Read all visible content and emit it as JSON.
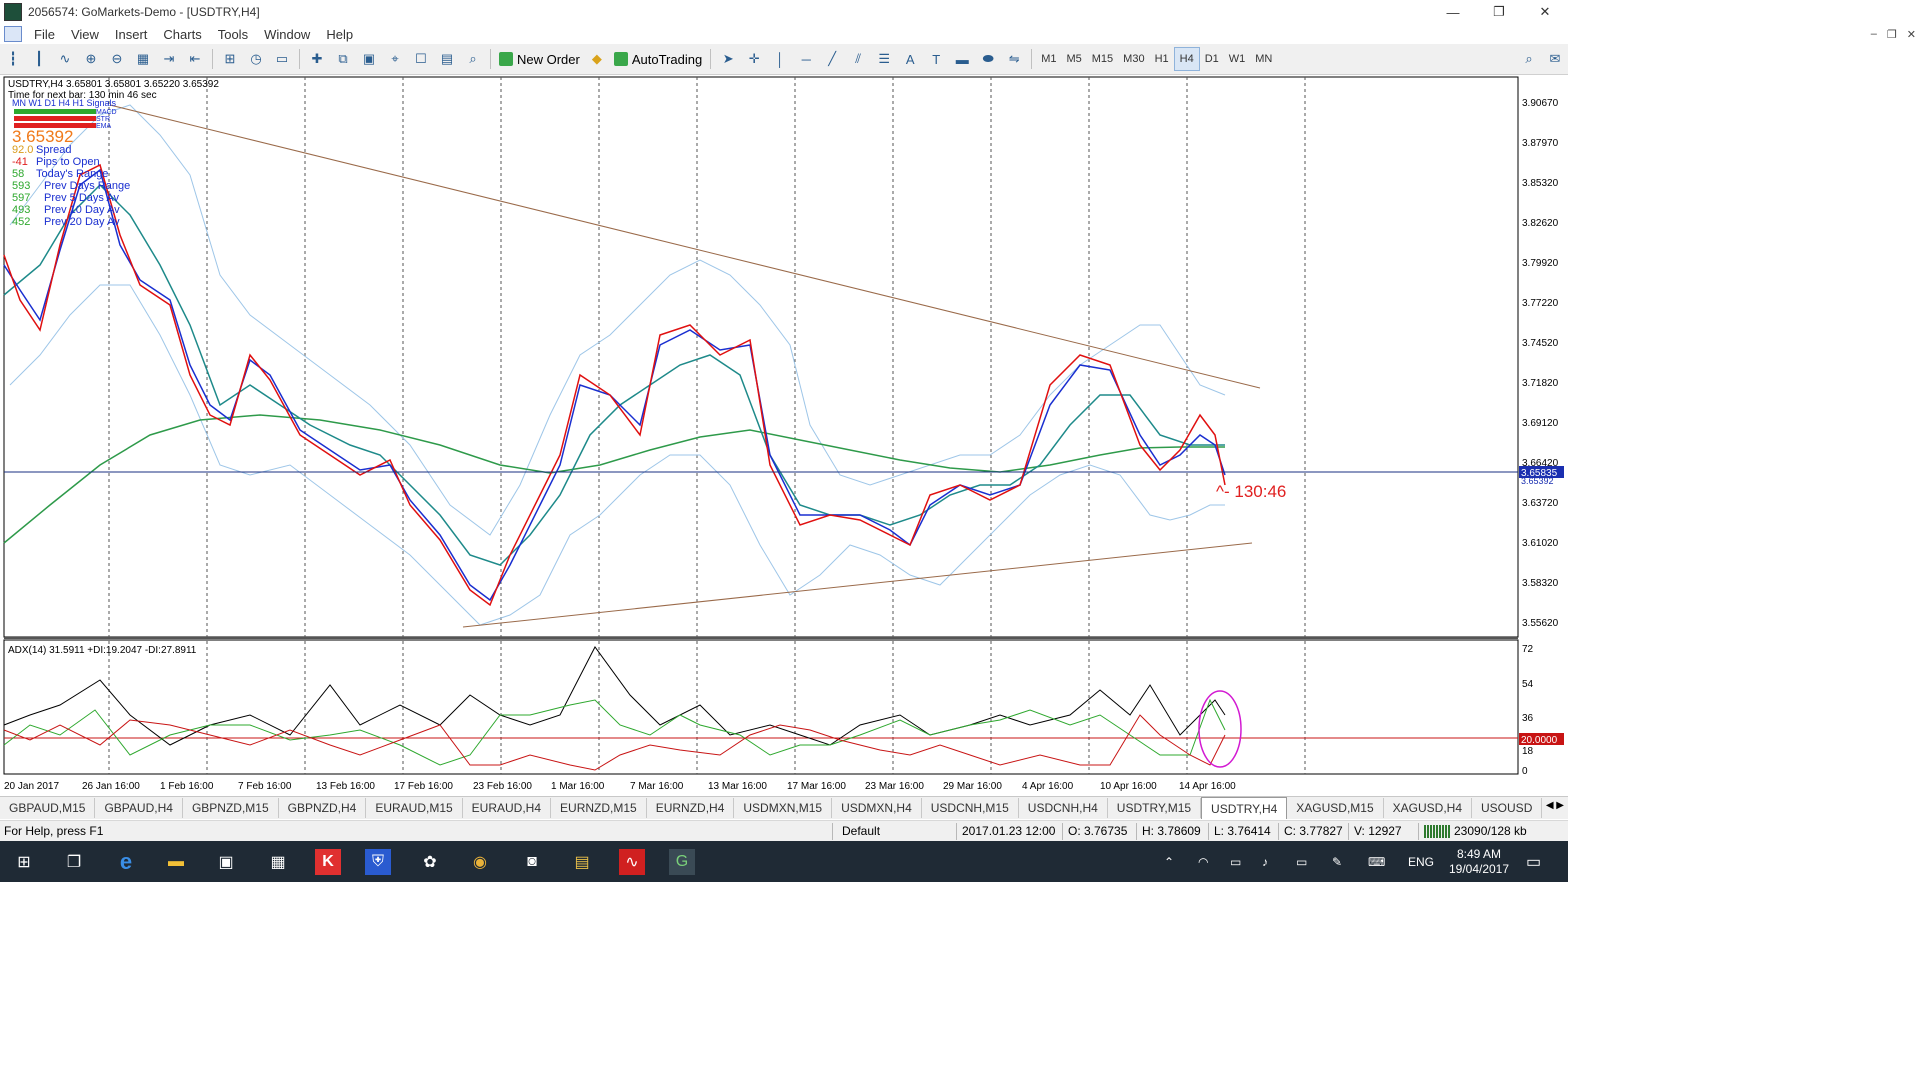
{
  "window": {
    "title": "2056574: GoMarkets-Demo - [USDTRY,H4]",
    "minimize": "—",
    "restore": "❐",
    "close": "✕"
  },
  "menu": [
    "File",
    "View",
    "Insert",
    "Charts",
    "Tools",
    "Window",
    "Help"
  ],
  "toolbar": {
    "new_order": "New Order",
    "autotrading": "AutoTrading",
    "timeframes": [
      "M1",
      "M5",
      "M15",
      "M30",
      "H1",
      "H4",
      "D1",
      "W1",
      "MN"
    ],
    "active_timeframe": "H4"
  },
  "chart": {
    "header": "USDTRY,H4  3.65801 3.65801 3.65220 3.65392",
    "time_next_bar": "Time for next bar: 130 min 46 sec",
    "signals_label": "MN W1 D1 H4 H1  Signals",
    "indicator_labels": [
      "MACD",
      "STR",
      "EMA"
    ],
    "big_price": "3.65392",
    "stats": [
      {
        "value": "92.0",
        "label": "Spread",
        "color": "#d99a1a"
      },
      {
        "value": "-41",
        "label": "Pips to Open",
        "color": "#e02020"
      },
      {
        "value": "58",
        "label": "Today's Range",
        "color": "#2ea82e"
      },
      {
        "value": "593",
        "label": "Prev Days Range",
        "color": "#2ea82e"
      },
      {
        "value": "597",
        "label": "Prev 5 Days Av",
        "color": "#2ea82e"
      },
      {
        "value": "493",
        "label": "Prev 10 Day Av",
        "color": "#2ea82e"
      },
      {
        "value": "452",
        "label": "Prev 20 Day Av",
        "color": "#2ea82e"
      }
    ],
    "countdown": "^- 130:46",
    "price_axis": [
      "3.90670",
      "3.87970",
      "3.85320",
      "3.82620",
      "3.79920",
      "3.77220",
      "3.74520",
      "3.71820",
      "3.69120",
      "3.66420",
      "3.63720",
      "3.61020",
      "3.58320",
      "3.55620"
    ],
    "current_price_label": "3.65835",
    "bid_label": "3.65392",
    "time_axis": [
      "20 Jan 2017",
      "26 Jan 16:00",
      "1 Feb 16:00",
      "7 Feb 16:00",
      "13 Feb 16:00",
      "17 Feb 16:00",
      "23 Feb 16:00",
      "1 Mar 16:00",
      "7 Mar 16:00",
      "13 Mar 16:00",
      "17 Mar 16:00",
      "23 Mar 16:00",
      "29 Mar 16:00",
      "4 Apr 16:00",
      "10 Apr 16:00",
      "14 Apr 16:00"
    ],
    "adx_header": "ADX(14) 31.5911 +DI:19.2047 -DI:27.8911",
    "adx_axis": [
      "72",
      "54",
      "36",
      "18",
      "0"
    ],
    "adx_level_label": "20.0000",
    "colors": {
      "price_fast": "#e01010",
      "price_slow": "#1a2fd0",
      "ema_teal": "#1e8a8a",
      "ema_long": "#2e9a4a",
      "bollinger": "#9ec6e8",
      "trendline": "#9a6a4a",
      "adx": "#000000",
      "plus_di": "#2ea82e",
      "minus_di": "#c81414",
      "circle": "#d21ad2"
    }
  },
  "tabs": [
    "GBPAUD,M15",
    "GBPAUD,H4",
    "GBPNZD,M15",
    "GBPNZD,H4",
    "EURAUD,M15",
    "EURAUD,H4",
    "EURNZD,M15",
    "EURNZD,H4",
    "USDMXN,M15",
    "USDMXN,H4",
    "USDCNH,M15",
    "USDCNH,H4",
    "USDTRY,M15",
    "USDTRY,H4",
    "XAGUSD,M15",
    "XAGUSD,H4",
    "USOUSD"
  ],
  "active_tab": "USDTRY,H4",
  "status": {
    "help": "For Help, press F1",
    "profile": "Default",
    "datetime": "2017.01.23 12:00",
    "open": "O: 3.76735",
    "high": "H: 3.78609",
    "low": "L: 3.76414",
    "close": "C: 3.77827",
    "volume": "V: 12927",
    "traffic": "23090/128 kb"
  },
  "taskbar": {
    "language": "ENG",
    "time": "8:49 AM",
    "date": "19/04/2017"
  }
}
